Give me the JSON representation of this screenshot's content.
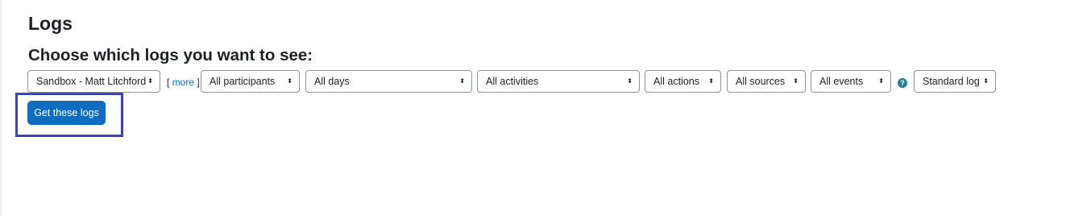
{
  "page": {
    "title": "Logs",
    "heading": "Choose which logs you want to see:"
  },
  "filters": {
    "course": "Sandbox - Matt Litchford",
    "more_open": "[",
    "more_label": "more",
    "more_close": "]",
    "participants": "All participants",
    "days": "All days",
    "activities": "All activities",
    "actions": "All actions",
    "sources": "All sources",
    "events": "All events",
    "help_icon": "?",
    "log_store": "Standard log"
  },
  "icons": {
    "select_arrows": "⬍",
    "help": "question-circle"
  },
  "actions": {
    "get_logs_label": "Get these logs"
  },
  "colors": {
    "primary": "#0f6cbf",
    "help_icon": "#1f7e9a",
    "highlight": "#3c3fc8"
  }
}
